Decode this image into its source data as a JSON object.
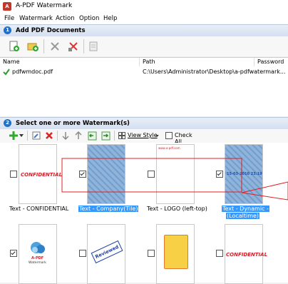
{
  "app": {
    "title": "A-PDF Watermark",
    "icon_text": "A"
  },
  "menu": [
    "File",
    "Watermark",
    "Action",
    "Option",
    "Help"
  ],
  "section1": {
    "number": "1",
    "title": "Add PDF Documents"
  },
  "file_list": {
    "columns": [
      "Name",
      "Path",
      "Password"
    ],
    "rows": [
      {
        "name": "pdfwmdoc.pdf",
        "path": "C:\\Users\\Administrator\\Desktop\\a-pdfwatermark..."
      }
    ]
  },
  "section2": {
    "number": "2",
    "title": "Select one or more Watermark(s)"
  },
  "toolbar2": {
    "view_style_label": "View Style",
    "check_all_label": "Check All"
  },
  "watermarks": [
    {
      "label": "Text - CONFIDENTIAL",
      "checked": false,
      "selected": false,
      "thumb_text": "CONFIDENTIAL"
    },
    {
      "label": "Text - Company(Tile)",
      "checked": true,
      "selected": true,
      "thumb_text": ""
    },
    {
      "label": "Text - LOGO (left-top)",
      "checked": false,
      "selected": false,
      "thumb_text": "www.a-pdf.com"
    },
    {
      "label": "Text - Dynamic -",
      "label2": "(Localtime)",
      "checked": true,
      "selected": true,
      "thumb_text": "15-03-2010 23:19"
    },
    {
      "label": "",
      "checked": true,
      "selected": false,
      "thumb_text": "A-PDF",
      "thumb_text2": "Watermark"
    },
    {
      "label": "",
      "checked": false,
      "selected": false,
      "thumb_text": "Reviewed"
    },
    {
      "label": "",
      "checked": false,
      "selected": false,
      "thumb_text": ""
    },
    {
      "label": "",
      "checked": false,
      "selected": false,
      "thumb_text": "CONFIDENTIAL"
    }
  ],
  "colors": {
    "accent": "#1e70c8",
    "highlight": "#3399ff",
    "selection_red": "#e02020"
  }
}
